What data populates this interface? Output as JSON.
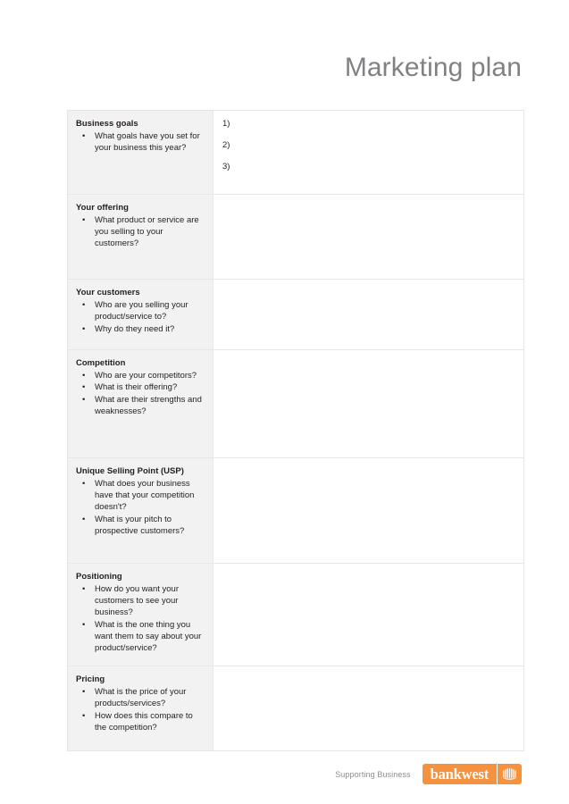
{
  "document": {
    "title": "Marketing plan"
  },
  "table": {
    "rows": [
      {
        "heading": "Business goals",
        "questions": [
          "What goals have you set for your business this year?"
        ],
        "answers": [
          "1)",
          "2)",
          "3)"
        ]
      },
      {
        "heading": "Your offering",
        "questions": [
          "What product or service are you selling to your customers?"
        ],
        "answers": []
      },
      {
        "heading": "Your customers",
        "questions": [
          "Who are you selling your product/service to?",
          "Why do they need it?"
        ],
        "answers": []
      },
      {
        "heading": "Competition",
        "questions": [
          "Who are your competitors?",
          "What is their offering?",
          "What are their strengths and weaknesses?"
        ],
        "answers": []
      },
      {
        "heading": "Unique Selling Point (USP)",
        "questions": [
          "What does your business have that your competition doesn't?",
          "What is your pitch to prospective customers?"
        ],
        "answers": []
      },
      {
        "heading": "Positioning",
        "questions": [
          "How do you want your customers to see your business?",
          "What is the one thing you want them to say about your product/service?"
        ],
        "answers": []
      },
      {
        "heading": "Pricing",
        "questions": [
          "What is the price of your products/services?",
          "How does this compare to the competition?"
        ],
        "answers": []
      }
    ],
    "bullet_glyph": "•"
  },
  "footer": {
    "supporting_text": "Supporting Business",
    "logo_word": "bankwest",
    "logo_mark_icon": "bankwest-swan-icon"
  },
  "colors": {
    "brand_orange": "#F6913D",
    "title_gray": "#808184",
    "prompt_background": "#F2F2F2",
    "table_border": "#E6E6E6",
    "body_text": "#231F20",
    "footer_text": "#8D8D8D"
  }
}
